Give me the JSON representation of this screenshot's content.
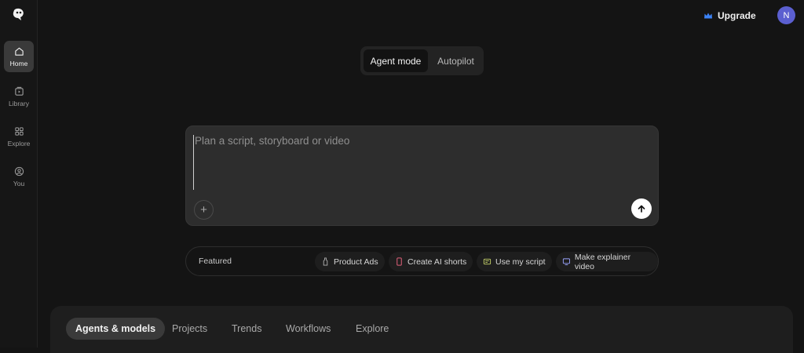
{
  "sidebar": {
    "items": [
      {
        "label": "Home",
        "icon": "home-icon",
        "active": true
      },
      {
        "label": "Library",
        "icon": "library-icon",
        "active": false
      },
      {
        "label": "Explore",
        "icon": "grid-icon",
        "active": false
      },
      {
        "label": "You",
        "icon": "user-icon",
        "active": false
      }
    ]
  },
  "header": {
    "upgrade_label": "Upgrade",
    "avatar_initial": "N"
  },
  "mode_toggle": {
    "active": "Agent mode",
    "other": "Autopilot"
  },
  "prompt": {
    "placeholder": "Plan a script, storyboard or video",
    "value": ""
  },
  "featured": {
    "label": "Featured",
    "chips": [
      {
        "label": "Product Ads",
        "icon": "bottle-icon"
      },
      {
        "label": "Create AI shorts",
        "icon": "phone-icon"
      },
      {
        "label": "Use my script",
        "icon": "script-icon"
      },
      {
        "label": "Make explainer video",
        "icon": "monitor-icon"
      }
    ]
  },
  "bottom_tabs": [
    {
      "label": "Agents & models",
      "active": true
    },
    {
      "label": "Projects",
      "active": false
    },
    {
      "label": "Trends",
      "active": false
    },
    {
      "label": "Workflows",
      "active": false
    },
    {
      "label": "Explore",
      "active": false
    }
  ],
  "colors": {
    "background": "#141414",
    "accent_crown": "#3b82f6",
    "avatar": "#5b5fd0"
  }
}
